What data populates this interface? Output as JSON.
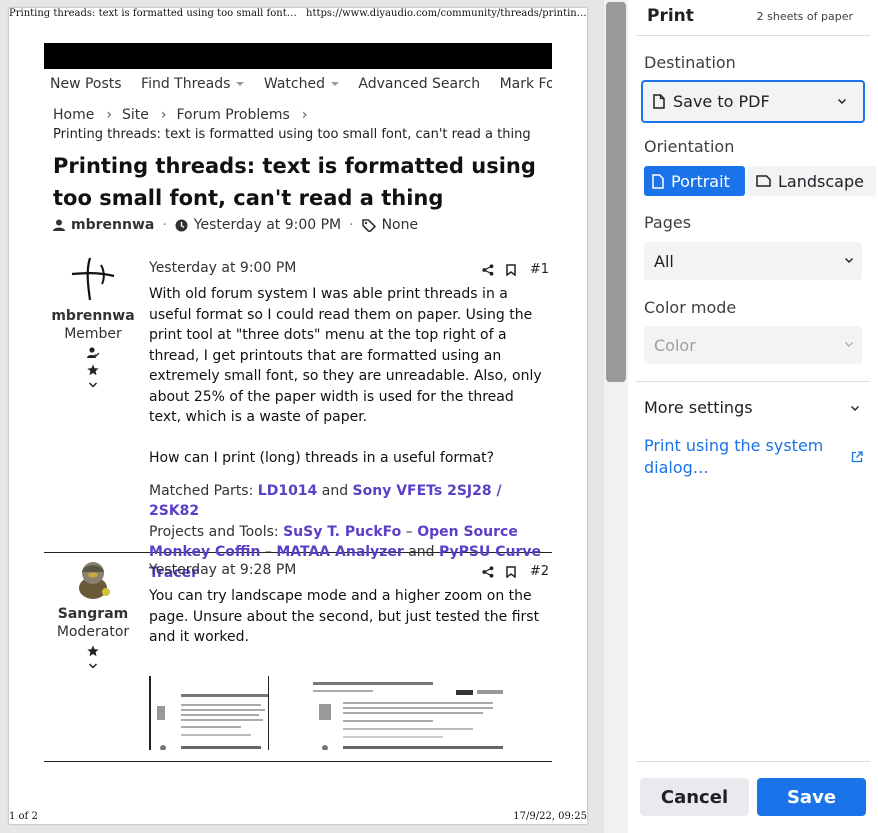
{
  "preview": {
    "header_title": "Printing threads: text is formatted using too small font,...",
    "header_url": "https://www.diyaudio.com/community/threads/printing-...",
    "footer_page": "1 of 2",
    "footer_date": "17/9/22, 09:25",
    "nav": [
      {
        "label": "New Posts",
        "caret": false
      },
      {
        "label": "Find Threads",
        "caret": true
      },
      {
        "label": "Watched",
        "caret": true
      },
      {
        "label": "Advanced Search",
        "caret": false
      },
      {
        "label": "Mark Forums R",
        "caret": false
      }
    ],
    "breadcrumb": [
      "Home",
      "Site",
      "Forum Problems"
    ],
    "thread_subtitle": "Printing threads: text is formatted using too small font, can't read a thing",
    "thread_title": "Printing threads: text is formatted using too small font, can't read a thing",
    "meta": {
      "author": "mbrennwa",
      "time": "Yesterday at 9:00 PM",
      "tags": "None"
    },
    "posts": [
      {
        "user": "mbrennwa",
        "role": "Member",
        "date": "Yesterday at 9:00 PM",
        "num": "#1",
        "text": "With old forum system I was able print threads in a useful format so I could read them on paper. Using the print tool at \"three dots\" menu at the top right of a thread, I get printouts that are formatted using an extremely small font, so they are unreadable. Also, only about 25% of the paper width is used for the thread text, which is a waste of paper.\n\nHow can I print (long) threads in a useful format?",
        "sig": {
          "matched_label": "Matched Parts:",
          "part1": "LD1014",
          "and1": "and",
          "part2": "Sony VFETs 2SJ28 / 2SK82",
          "projects_label": "Projects and Tools:",
          "tool1": "SuSy T. PuckFo",
          "dash1": "–",
          "tool2": "Open Source Monkey Coffin",
          "dash2": "–",
          "tool3": "MATAA Analyzer",
          "and2": "and",
          "tool4": "PyPSU Curve Tracer"
        }
      },
      {
        "user": "Sangram",
        "role": "Moderator",
        "date": "Yesterday at 9:28 PM",
        "num": "#2",
        "text": "You can try landscape mode and a higher zoom on the page. Unsure about the second, but just tested the first and it worked."
      }
    ]
  },
  "print": {
    "title": "Print",
    "sheets": "2 sheets of paper",
    "destination_label": "Destination",
    "destination_value": "Save to PDF",
    "orientation_label": "Orientation",
    "orientation_portrait": "Portrait",
    "orientation_landscape": "Landscape",
    "orientation_selected": "Portrait",
    "pages_label": "Pages",
    "pages_value": "All",
    "colormode_label": "Color mode",
    "colormode_value": "Color",
    "more_settings": "More settings",
    "system_dialog": "Print using the system dialog…",
    "cancel": "Cancel",
    "save": "Save"
  },
  "colors": {
    "accent": "#1a73e8",
    "link": "#5b40c6"
  }
}
